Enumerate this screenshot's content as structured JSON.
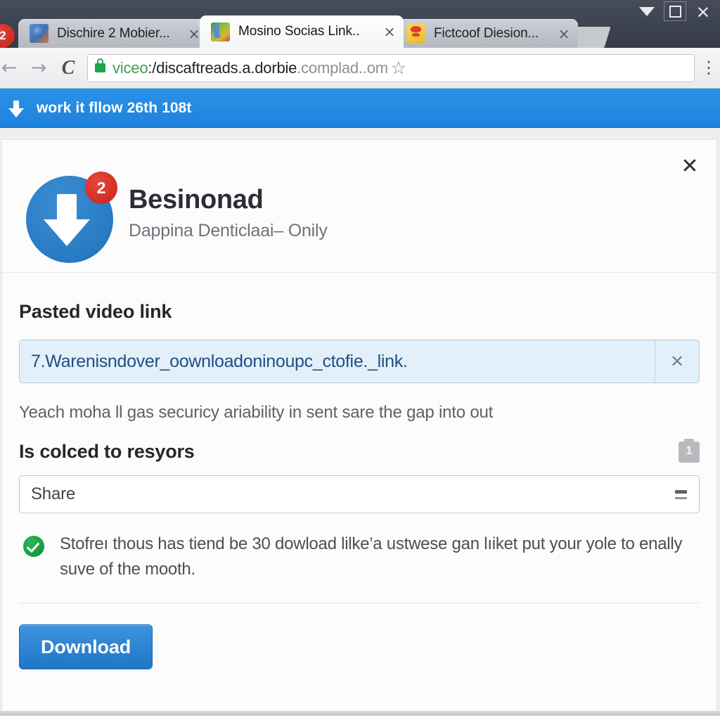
{
  "window": {
    "controls": [
      {
        "name": "minimize",
        "glyph": "caret-down"
      },
      {
        "name": "restore",
        "glyph": "square"
      },
      {
        "name": "close",
        "glyph": "×"
      }
    ]
  },
  "browser": {
    "left_badge_count": "2",
    "tabs": [
      {
        "title": "Dischire 2 Mobier...",
        "close": "×",
        "active": false,
        "favicon": "blue-orange-favicon"
      },
      {
        "title": "Mosino Socias Link..",
        "close": "×",
        "active": true,
        "favicon": "green-map-favicon"
      },
      {
        "title": "Fictcoof Diesion...",
        "close": "×",
        "active": false,
        "favicon": "yellow-red-favicon"
      }
    ],
    "nav": {
      "back": "←",
      "forward": "→",
      "reload": "C"
    },
    "address": {
      "lock_icon": "lock-icon",
      "scheme": "viceo",
      "host": ":/discaftreads.a.dorbie",
      "rest": ".complad..om",
      "bookmark_star": "☆",
      "menu": "⋮"
    }
  },
  "notification_bar": {
    "icon": "download-arrow-icon",
    "text": "work it fllow 26th 108t"
  },
  "dialog": {
    "close_label": "✕",
    "header": {
      "badge_count": "2",
      "title": "Besinonad",
      "subtitle": "Dappina Denticlaai– Onily"
    },
    "link_section": {
      "label": "Pasted video link",
      "value": "7.Warenisndover_oownloadoninoupc_ctofie._link.",
      "clear_icon": "✕"
    },
    "helper_text": "Yeach moha ll gas securicy ariability in sent sare the gap into out",
    "options_section": {
      "label": "Is colced to resyors",
      "info_icon": "note-icon",
      "select_value": "Share",
      "select_indicator": "updown-arrows-icon"
    },
    "note": {
      "status_icon": "check-circle-icon",
      "text": "Stofreı thous has tiend be 30 dowload lilke’a ustwese gan lıiket put your yole to enally suve of the mooth."
    },
    "primary_button": "Download"
  },
  "colors": {
    "accent_blue": "#2476be",
    "bar_blue": "#1e82dc",
    "badge_red": "#c9231b",
    "ok_green": "#14a33f",
    "chrome_dark": "#3c4250"
  }
}
